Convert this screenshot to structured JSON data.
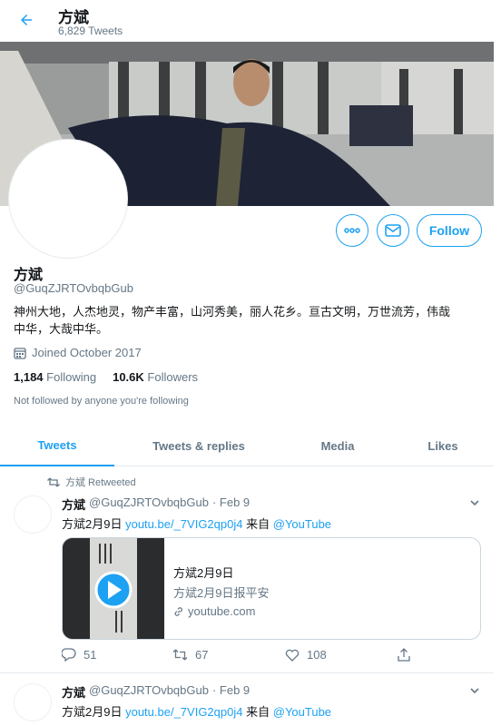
{
  "header": {
    "name": "方斌",
    "tweet_count": "6,829 Tweets"
  },
  "profile": {
    "name": "方斌",
    "handle": "@GuqZJRTOvbqbGub",
    "bio_line1": "神州大地，人杰地灵，物产丰富，山河秀美，丽人花乡。亘古文明，万世流芳，伟哉",
    "bio_line2": "中华，大哉中华。",
    "joined": "Joined October 2017",
    "following_count": "1,184",
    "following_label": "Following",
    "followers_count": "10.6K",
    "followers_label": "Followers",
    "not_followed": "Not followed by anyone you're following",
    "follow_button": "Follow",
    "icons": [
      "more-icon",
      "message-icon",
      "calendar-icon",
      "back-arrow-icon"
    ]
  },
  "tabs": [
    {
      "label": "Tweets",
      "active": true
    },
    {
      "label": "Tweets & replies",
      "active": false
    },
    {
      "label": "Media",
      "active": false
    },
    {
      "label": "Likes",
      "active": false
    }
  ],
  "tweets": [
    {
      "retweeted_label": "方斌 Retweeted",
      "name": "方斌",
      "handle": "@GuqZJRTOvbqbGub",
      "date": "· Feb 9",
      "text_prefix": "方斌2月9日",
      "link": "youtu.be/_7VIG2qp0j4",
      "text_mid": "来自",
      "mention": "@YouTube",
      "card": {
        "title": "方斌2月9日",
        "description": "方斌2月9日报平安",
        "url": "youtube.com"
      },
      "replies": "51",
      "retweets": "67",
      "likes": "108"
    },
    {
      "name": "方斌",
      "handle": "@GuqZJRTOvbqbGub",
      "date": "· Feb 9",
      "text_prefix": "方斌2月9日",
      "link": "youtu.be/_7VIG2qp0j4",
      "text_mid": "来自",
      "mention": "@YouTube"
    }
  ],
  "colors": {
    "accent": "#1da1f2",
    "secondary_text": "#657786",
    "border": "#e6ecf0"
  }
}
